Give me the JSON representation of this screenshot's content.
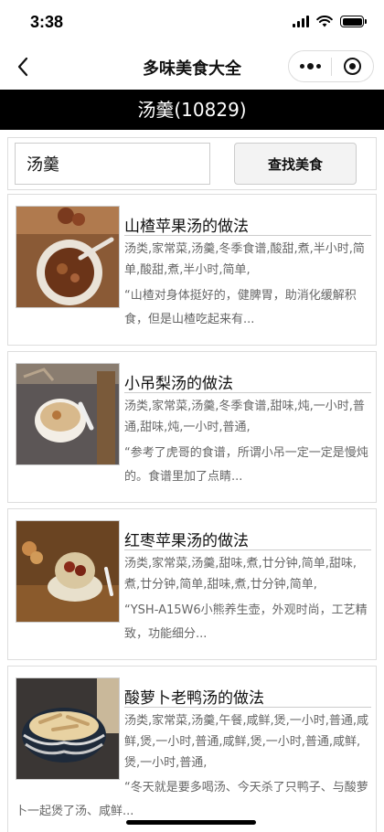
{
  "status_bar": {
    "time": "3:38",
    "icons": [
      "signal-icon",
      "wifi-icon",
      "battery-icon"
    ]
  },
  "nav": {
    "title": "多味美食大全",
    "back_icon": "chevron-left-icon",
    "more_icon": "more-dots-icon",
    "close_icon": "target-circle-icon"
  },
  "category": {
    "label": "汤羹(10829)"
  },
  "search": {
    "value": "汤羹",
    "button_label": "查找美食"
  },
  "recipes": [
    {
      "title": "山楂苹果汤的做法",
      "tags": "汤类,家常菜,汤羹,冬季食谱,酸甜,煮,半小时,简单,酸甜,煮,半小时,简单,",
      "desc": "“山楂对身体挺好的，健脾胃，助消化缓解积食，但是山楂吃起来有..."
    },
    {
      "title": "小吊梨汤的做法",
      "tags": "汤类,家常菜,汤羹,冬季食谱,甜味,炖,一小时,普通,甜味,炖,一小时,普通,",
      "desc": "“参考了虎哥的食谱，所谓小吊一定一定是慢炖的。食谱里加了点睛..."
    },
    {
      "title": "红枣苹果汤的做法",
      "tags": "汤类,家常菜,汤羹,甜味,煮,廿分钟,简单,甜味,煮,廿分钟,简单,甜味,煮,廿分钟,简单,",
      "desc": "“YSH-A15W6小熊养生壶，外观时尚，工艺精致，功能细分..."
    },
    {
      "title": "酸萝卜老鸭汤的做法",
      "tags": "汤类,家常菜,汤羹,午餐,咸鲜,煲,一小时,普通,咸鲜,煲,一小时,普通,咸鲜,煲,一小时,普通,咸鲜,煲,一小时,普通,",
      "desc": "“冬天就是要多喝汤、今天杀了只鸭子、与酸萝卜一起煲了汤、咸鲜..."
    }
  ],
  "colors": {
    "banner_bg": "#000000",
    "banner_text": "#ffffff",
    "meta_text": "#666666",
    "title_text": "#111111"
  }
}
